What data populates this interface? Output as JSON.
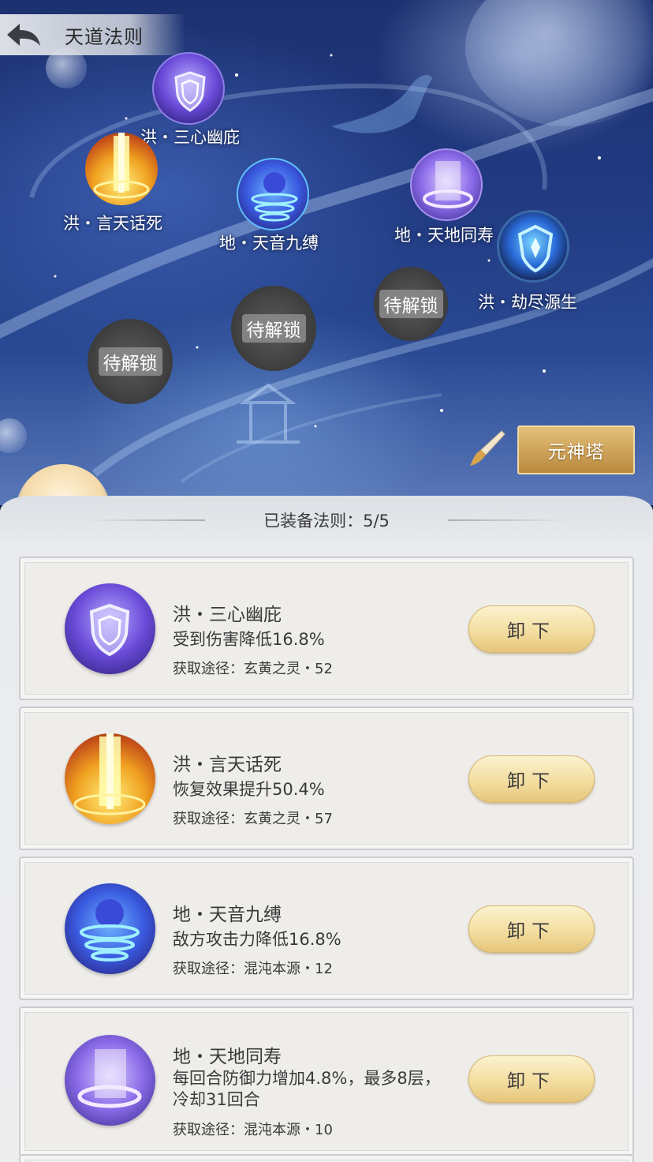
{
  "header": {
    "title": "天道法则"
  },
  "map": {
    "nodes": [
      {
        "label": "洪・三心幽庇",
        "icon": "shield-icon"
      },
      {
        "label": "洪・言天话死",
        "icon": "light-pillar-icon"
      },
      {
        "label": "地・天音九缚",
        "icon": "whirlwind-icon"
      },
      {
        "label": "地・天地同寿",
        "icon": "pillar-ring-icon"
      },
      {
        "label": "洪・劫尽源生",
        "icon": "crystal-shield-icon"
      }
    ],
    "locked": [
      "待解锁",
      "待解锁",
      "待解锁"
    ],
    "tower_button": "元神塔"
  },
  "panel": {
    "equipped_label": "已装备法则：5/5",
    "unload_label": "卸下",
    "cards": [
      {
        "name": "洪・三心幽庇",
        "effect": "受到伤害降低16.8%",
        "source": "获取途径：玄黄之灵・52",
        "icon": "shield-icon"
      },
      {
        "name": "洪・言天话死",
        "effect": "恢复效果提升50.4%",
        "source": "获取途径：玄黄之灵・57",
        "icon": "light-pillar-icon"
      },
      {
        "name": "地・天音九缚",
        "effect": "敌方攻击力降低16.8%",
        "source": "获取途径：混沌本源・12",
        "icon": "whirlwind-icon"
      },
      {
        "name": "地・天地同寿",
        "effect": "每回合防御力增加4.8%，最多8层，冷却31回合",
        "source": "获取途径：混沌本源・10",
        "icon": "pillar-ring-icon"
      }
    ]
  },
  "colors": {
    "gold_button": "#cfa45a",
    "unload_button": "#f3dea0",
    "sky": "#213a82"
  }
}
